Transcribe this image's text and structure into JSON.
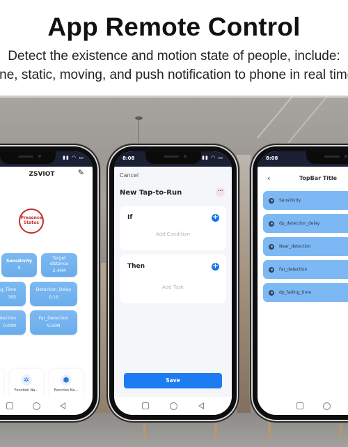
{
  "header": {
    "title": "App Remote Control",
    "subtitle_line1": "Detect the existence and motion state of people, include:",
    "subtitle_line2": "none, static, moving, and push notification to phone in real time"
  },
  "phones": {
    "device_home": {
      "app_title": "ZSVIOT",
      "edit_icon": "pencil-icon",
      "presence": {
        "line1": "Presence",
        "line2": "Status",
        "color": "#c62c2c"
      },
      "tiles": [
        {
          "label": "",
          "value": ""
        },
        {
          "label": "Sensitivity",
          "value": "9"
        },
        {
          "label": "Target distance",
          "value": "2.44M"
        },
        {
          "label": "Fading_Time",
          "value": "30S"
        },
        {
          "label": "Detection_Delay",
          "value": "0.1S"
        },
        {
          "label": "Near_Detection",
          "value": "0.00M"
        },
        {
          "label": "Far_Detection",
          "value": "9.50M"
        }
      ],
      "tile_color": "#72b2ee",
      "functions": [
        {
          "label": "Function Na...",
          "icon": "function-icon"
        },
        {
          "label": "Function Na...",
          "icon": "snowflake-icon"
        },
        {
          "label": "Function Na...",
          "icon": "hexagon-icon"
        }
      ]
    },
    "tap_to_run": {
      "status_time": "8:08",
      "cancel_label": "Cancel",
      "title": "New Tap-to-Run",
      "more_icon": "more-icon",
      "if_label": "If",
      "add_condition_hint": "Add Condition",
      "then_label": "Then",
      "add_task_hint": "Add Task",
      "save_label": "Save",
      "accent_color": "#1e7cf2"
    },
    "settings_list": {
      "status_time": "8:08",
      "back_icon": "chevron-left-icon",
      "title": "TopBar Title",
      "items": [
        {
          "label": "Sensitivity"
        },
        {
          "label": "dp_detection_delay"
        },
        {
          "label": "Near_detection"
        },
        {
          "label": "Far_detection"
        },
        {
          "label": "dp_fading_time"
        }
      ],
      "item_color": "#7cb8f4"
    }
  }
}
